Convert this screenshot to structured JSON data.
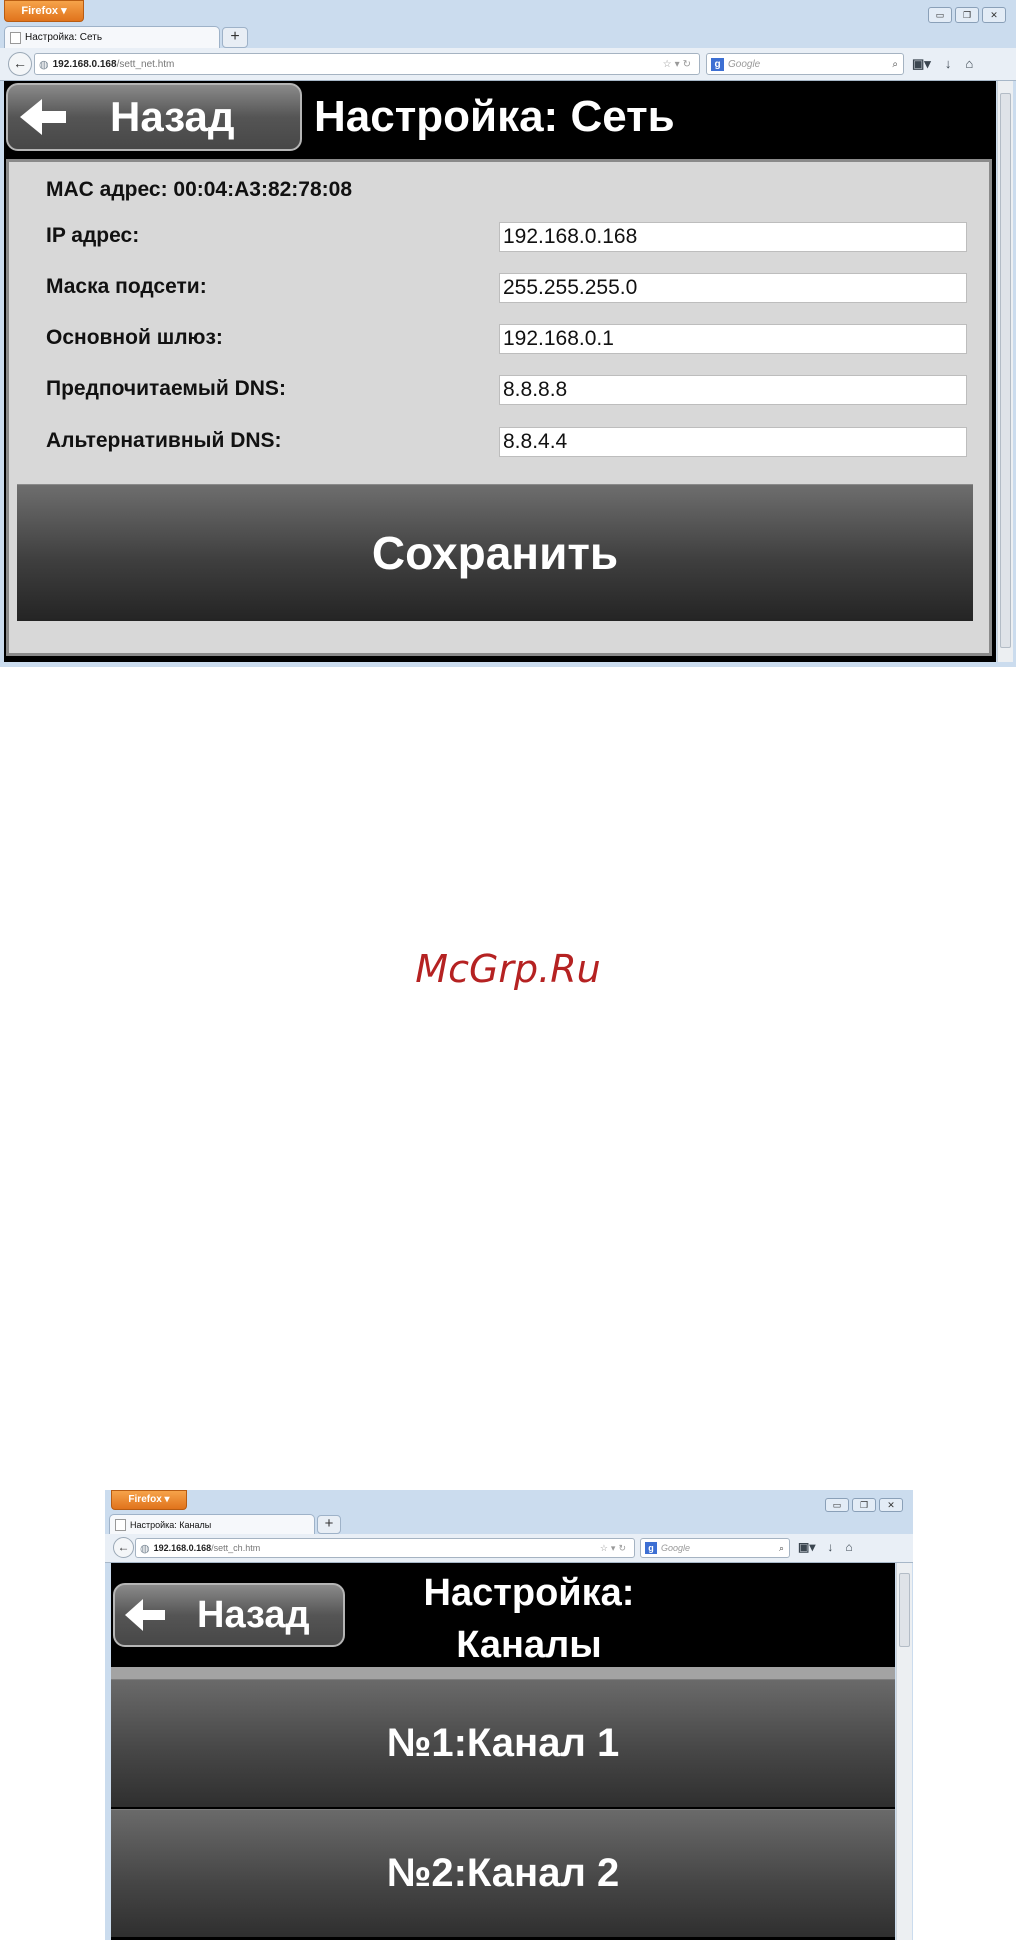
{
  "screen1": {
    "browser": {
      "app_button": "Firefox",
      "tab_title": "Настройка: Сеть",
      "url_host": "192.168.0.168",
      "url_path": "/sett_net.htm",
      "search_placeholder": "Google",
      "new_tab": "+"
    },
    "header": {
      "back_label": "Назад",
      "title": "Настройка: Сеть"
    },
    "form": {
      "mac_line": "MAC адрес: 00:04:A3:82:78:08",
      "fields": [
        {
          "label": "IP адрес:",
          "value": "192.168.0.168"
        },
        {
          "label": "Маска подсети:",
          "value": "255.255.255.0"
        },
        {
          "label": "Основной шлюз:",
          "value": "192.168.0.1"
        },
        {
          "label": "Предпочитаемый DNS:",
          "value": "8.8.8.8"
        },
        {
          "label": "Альтернативный DNS:",
          "value": "8.8.4.4"
        }
      ],
      "save_label": "Сохранить"
    }
  },
  "watermark": "McGrp.Ru",
  "screen2": {
    "browser": {
      "app_button": "Firefox",
      "tab_title": "Настройка: Каналы",
      "url_host": "192.168.0.168",
      "url_path": "/sett_ch.htm",
      "search_placeholder": "Google",
      "new_tab": "+"
    },
    "header": {
      "back_label": "Назад",
      "title": "Настройка: Каналы"
    },
    "channels": [
      {
        "label": "№1:Канал 1"
      },
      {
        "label": "№2:Канал 2"
      }
    ]
  }
}
